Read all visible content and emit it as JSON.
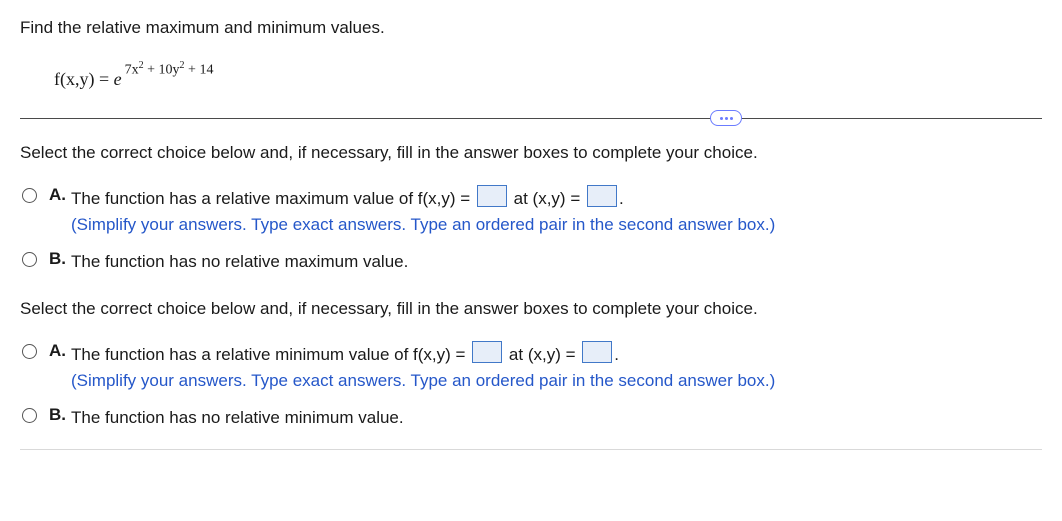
{
  "prompt": "Find the relative maximum and minimum values.",
  "formula": {
    "lhs": "f(x,y) = ",
    "base": "e",
    "exp_html": "7x² + 10y² + 14"
  },
  "group1": {
    "instruction": "Select the correct choice below and, if necessary, fill in the answer boxes to complete your choice.",
    "A": {
      "letter": "A.",
      "pre": "The function has a relative maximum value of f(x,y) = ",
      "mid": " at (x,y) = ",
      "post": ".",
      "hint": "(Simplify your answers. Type exact answers. Type an ordered pair in the second answer box.)"
    },
    "B": {
      "letter": "B.",
      "text": "The function has no relative maximum value."
    }
  },
  "group2": {
    "instruction": "Select the correct choice below and, if necessary, fill in the answer boxes to complete your choice.",
    "A": {
      "letter": "A.",
      "pre": "The function has a relative minimum value of f(x,y) = ",
      "mid": " at (x,y) = ",
      "post": ".",
      "hint": "(Simplify your answers. Type exact answers. Type an ordered pair in the second answer box.)"
    },
    "B": {
      "letter": "B.",
      "text": "The function has no relative minimum value."
    }
  }
}
